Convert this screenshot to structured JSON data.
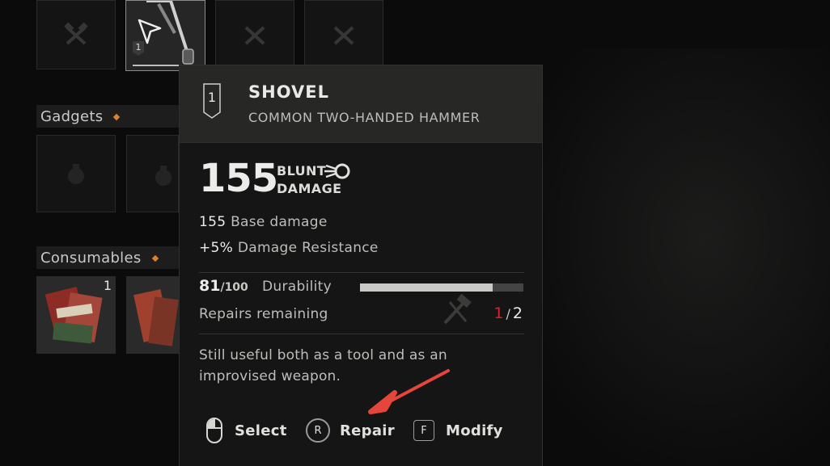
{
  "inventory": {
    "sections": {
      "gadgets": {
        "label": "Gadgets"
      },
      "consumables": {
        "label": "Consumables"
      }
    },
    "weapon_slots": {
      "selected_rank": "1"
    },
    "consumable_slots": [
      {
        "count": "1"
      },
      {
        "count": ""
      }
    ]
  },
  "tooltip": {
    "rank": "1",
    "name": "SHOVEL",
    "subtitle": "COMMON TWO-HANDED HAMMER",
    "damage": {
      "value": "155",
      "type_line1": "BLUNT",
      "type_line2": "DAMAGE",
      "type_icon": "blunt-damage-icon"
    },
    "stats": [
      {
        "value": "155",
        "label": "Base damage"
      },
      {
        "value": "+5%",
        "label": "Damage Resistance"
      }
    ],
    "durability": {
      "current": "81",
      "max": "/100",
      "label": "Durability",
      "fraction": 0.81
    },
    "repairs": {
      "label": "Repairs remaining",
      "current": "1",
      "separator": "/",
      "max": "2"
    },
    "description": "Still useful both as a tool and as an improvised weapon.",
    "actions": [
      {
        "key": "mouse-left-icon",
        "label": "Select"
      },
      {
        "key": "R",
        "label": "Repair"
      },
      {
        "key": "F",
        "label": "Modify"
      }
    ]
  },
  "colors": {
    "accent_orange": "#d9822b",
    "repairs_current": "#d8232a",
    "annotation_arrow": "#e5453a"
  }
}
